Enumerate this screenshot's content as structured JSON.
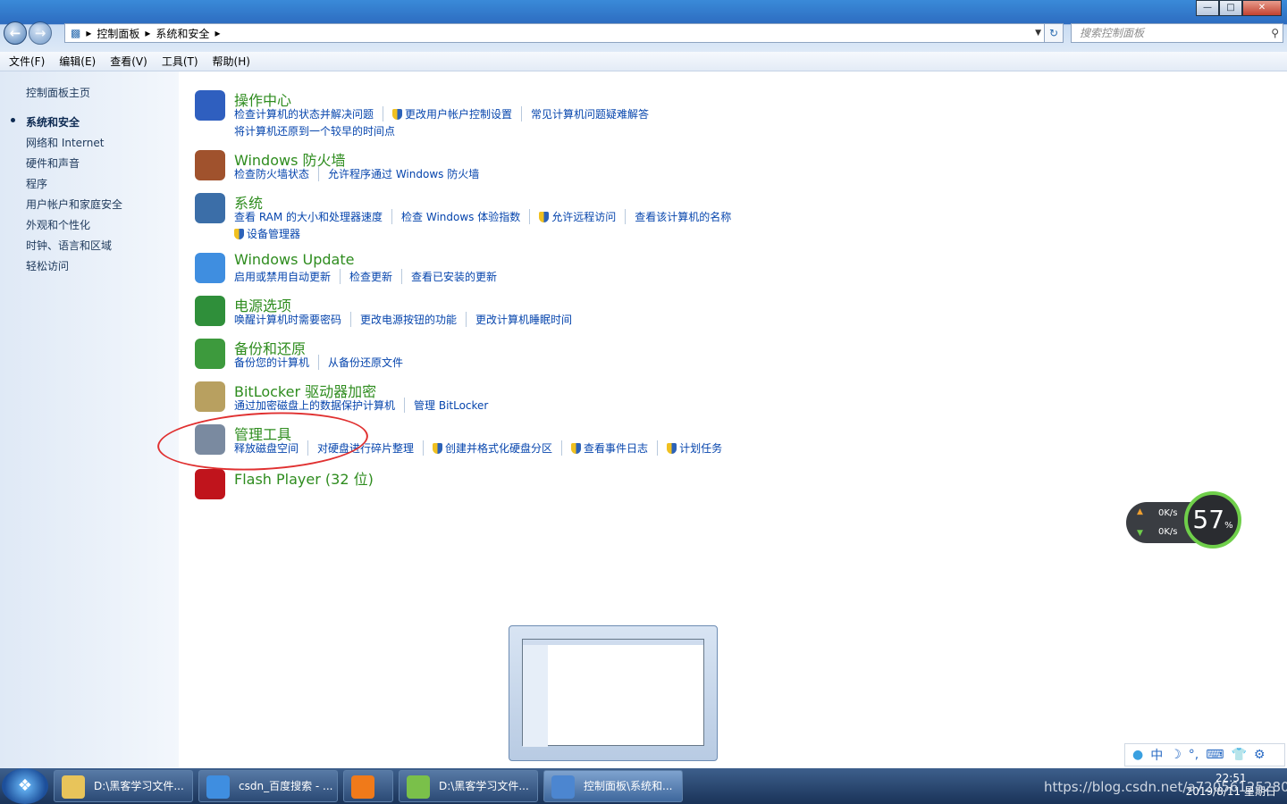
{
  "window": {
    "breadcrumb": [
      "控制面板",
      "系统和安全"
    ],
    "search_placeholder": "搜索控制面板",
    "controls": {
      "minimize": "—",
      "maximize": "□",
      "close": "✕"
    }
  },
  "menu": [
    "文件(F)",
    "编辑(E)",
    "查看(V)",
    "工具(T)",
    "帮助(H)"
  ],
  "sidebar": {
    "home": "控制面板主页",
    "items": [
      "系统和安全",
      "网络和 Internet",
      "硬件和声音",
      "程序",
      "用户帐户和家庭安全",
      "外观和个性化",
      "时钟、语言和区域",
      "轻松访问"
    ],
    "current_index": 0
  },
  "categories": [
    {
      "title": "操作中心",
      "icon": "flag-icon",
      "color": "#2f5fbf",
      "links": [
        [
          "检查计算机的状态并解决问题",
          "更改用户帐户控制设置",
          "常见计算机问题疑难解答"
        ],
        [
          "将计算机还原到一个较早的时间点"
        ]
      ],
      "shield": [
        [
          false,
          true,
          false
        ],
        [
          false
        ]
      ]
    },
    {
      "title": "Windows 防火墙",
      "icon": "firewall-icon",
      "color": "#a0522d",
      "links": [
        [
          "检查防火墙状态",
          "允许程序通过 Windows 防火墙"
        ]
      ],
      "shield": [
        [
          false,
          false
        ]
      ]
    },
    {
      "title": "系统",
      "icon": "computer-icon",
      "color": "#3b6ea8",
      "links": [
        [
          "查看 RAM 的大小和处理器速度",
          "检查 Windows 体验指数",
          "允许远程访问",
          "查看该计算机的名称"
        ],
        [
          "设备管理器"
        ]
      ],
      "shield": [
        [
          false,
          false,
          true,
          false
        ],
        [
          true
        ]
      ]
    },
    {
      "title": "Windows Update",
      "icon": "windows-update-icon",
      "color": "#3f8ee0",
      "links": [
        [
          "启用或禁用自动更新",
          "检查更新",
          "查看已安装的更新"
        ]
      ],
      "shield": [
        [
          false,
          false,
          false
        ]
      ]
    },
    {
      "title": "电源选项",
      "icon": "battery-icon",
      "color": "#2f8f3a",
      "links": [
        [
          "唤醒计算机时需要密码",
          "更改电源按钮的功能",
          "更改计算机睡眠时间"
        ]
      ],
      "shield": [
        [
          false,
          false,
          false
        ]
      ]
    },
    {
      "title": "备份和还原",
      "icon": "backup-icon",
      "color": "#3d9a3d",
      "links": [
        [
          "备份您的计算机",
          "从备份还原文件"
        ]
      ],
      "shield": [
        [
          false,
          false
        ]
      ]
    },
    {
      "title": "BitLocker 驱动器加密",
      "icon": "bitlocker-key-icon",
      "color": "#b8a060",
      "links": [
        [
          "通过加密磁盘上的数据保护计算机",
          "管理 BitLocker"
        ]
      ],
      "shield": [
        [
          false,
          false
        ]
      ]
    },
    {
      "title": "管理工具",
      "icon": "admin-tools-icon",
      "color": "#7a8aa0",
      "links": [
        [
          "释放磁盘空间",
          "对硬盘进行碎片整理",
          "创建并格式化硬盘分区",
          "查看事件日志",
          "计划任务"
        ]
      ],
      "shield": [
        [
          false,
          false,
          true,
          true,
          true
        ]
      ]
    },
    {
      "title": "Flash Player (32 位)",
      "icon": "flash-player-icon",
      "color": "#c0141c",
      "links": [],
      "shield": []
    }
  ],
  "net_widget": {
    "up": "0K/s",
    "down": "0K/s",
    "percent": "57",
    "percent_unit": "%"
  },
  "taskbar": {
    "tasks": [
      {
        "label": "D:\\黑客学习文件...",
        "icon": "folder-icon",
        "color": "#e8c45a"
      },
      {
        "label": "csdn_百度搜索 - ...",
        "icon": "ie-icon",
        "color": "#3f8ee0"
      },
      {
        "label": "",
        "icon": "media-player-icon",
        "color": "#f07a1a"
      },
      {
        "label": "D:\\黑客学习文件...",
        "icon": "notepad-icon",
        "color": "#7ac04a"
      },
      {
        "label": "控制面板\\系统和...",
        "icon": "control-panel-icon",
        "color": "#4c86d0"
      }
    ],
    "ime": [
      "中",
      "☽",
      "°,",
      "⌨",
      "👕",
      "⚙"
    ],
    "time": "22:51",
    "date": "2019/8/11 星期日",
    "watermark": "https://blog.csdn.net/a720561252803"
  }
}
